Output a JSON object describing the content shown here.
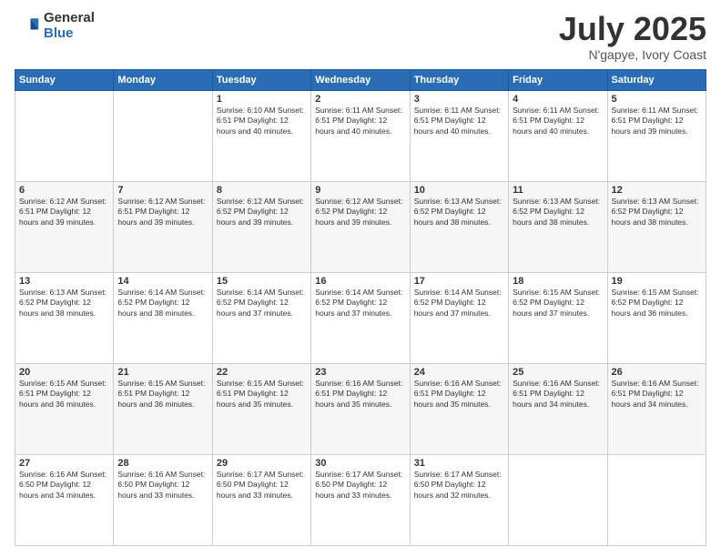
{
  "logo": {
    "general": "General",
    "blue": "Blue"
  },
  "title": "July 2025",
  "subtitle": "N'gapye, Ivory Coast",
  "days_of_week": [
    "Sunday",
    "Monday",
    "Tuesday",
    "Wednesday",
    "Thursday",
    "Friday",
    "Saturday"
  ],
  "weeks": [
    [
      {
        "day": "",
        "info": ""
      },
      {
        "day": "",
        "info": ""
      },
      {
        "day": "1",
        "info": "Sunrise: 6:10 AM\nSunset: 6:51 PM\nDaylight: 12 hours and 40 minutes."
      },
      {
        "day": "2",
        "info": "Sunrise: 6:11 AM\nSunset: 6:51 PM\nDaylight: 12 hours and 40 minutes."
      },
      {
        "day": "3",
        "info": "Sunrise: 6:11 AM\nSunset: 6:51 PM\nDaylight: 12 hours and 40 minutes."
      },
      {
        "day": "4",
        "info": "Sunrise: 6:11 AM\nSunset: 6:51 PM\nDaylight: 12 hours and 40 minutes."
      },
      {
        "day": "5",
        "info": "Sunrise: 6:11 AM\nSunset: 6:51 PM\nDaylight: 12 hours and 39 minutes."
      }
    ],
    [
      {
        "day": "6",
        "info": "Sunrise: 6:12 AM\nSunset: 6:51 PM\nDaylight: 12 hours and 39 minutes."
      },
      {
        "day": "7",
        "info": "Sunrise: 6:12 AM\nSunset: 6:51 PM\nDaylight: 12 hours and 39 minutes."
      },
      {
        "day": "8",
        "info": "Sunrise: 6:12 AM\nSunset: 6:52 PM\nDaylight: 12 hours and 39 minutes."
      },
      {
        "day": "9",
        "info": "Sunrise: 6:12 AM\nSunset: 6:52 PM\nDaylight: 12 hours and 39 minutes."
      },
      {
        "day": "10",
        "info": "Sunrise: 6:13 AM\nSunset: 6:52 PM\nDaylight: 12 hours and 38 minutes."
      },
      {
        "day": "11",
        "info": "Sunrise: 6:13 AM\nSunset: 6:52 PM\nDaylight: 12 hours and 38 minutes."
      },
      {
        "day": "12",
        "info": "Sunrise: 6:13 AM\nSunset: 6:52 PM\nDaylight: 12 hours and 38 minutes."
      }
    ],
    [
      {
        "day": "13",
        "info": "Sunrise: 6:13 AM\nSunset: 6:52 PM\nDaylight: 12 hours and 38 minutes."
      },
      {
        "day": "14",
        "info": "Sunrise: 6:14 AM\nSunset: 6:52 PM\nDaylight: 12 hours and 38 minutes."
      },
      {
        "day": "15",
        "info": "Sunrise: 6:14 AM\nSunset: 6:52 PM\nDaylight: 12 hours and 37 minutes."
      },
      {
        "day": "16",
        "info": "Sunrise: 6:14 AM\nSunset: 6:52 PM\nDaylight: 12 hours and 37 minutes."
      },
      {
        "day": "17",
        "info": "Sunrise: 6:14 AM\nSunset: 6:52 PM\nDaylight: 12 hours and 37 minutes."
      },
      {
        "day": "18",
        "info": "Sunrise: 6:15 AM\nSunset: 6:52 PM\nDaylight: 12 hours and 37 minutes."
      },
      {
        "day": "19",
        "info": "Sunrise: 6:15 AM\nSunset: 6:52 PM\nDaylight: 12 hours and 36 minutes."
      }
    ],
    [
      {
        "day": "20",
        "info": "Sunrise: 6:15 AM\nSunset: 6:51 PM\nDaylight: 12 hours and 36 minutes."
      },
      {
        "day": "21",
        "info": "Sunrise: 6:15 AM\nSunset: 6:51 PM\nDaylight: 12 hours and 36 minutes."
      },
      {
        "day": "22",
        "info": "Sunrise: 6:15 AM\nSunset: 6:51 PM\nDaylight: 12 hours and 35 minutes."
      },
      {
        "day": "23",
        "info": "Sunrise: 6:16 AM\nSunset: 6:51 PM\nDaylight: 12 hours and 35 minutes."
      },
      {
        "day": "24",
        "info": "Sunrise: 6:16 AM\nSunset: 6:51 PM\nDaylight: 12 hours and 35 minutes."
      },
      {
        "day": "25",
        "info": "Sunrise: 6:16 AM\nSunset: 6:51 PM\nDaylight: 12 hours and 34 minutes."
      },
      {
        "day": "26",
        "info": "Sunrise: 6:16 AM\nSunset: 6:51 PM\nDaylight: 12 hours and 34 minutes."
      }
    ],
    [
      {
        "day": "27",
        "info": "Sunrise: 6:16 AM\nSunset: 6:50 PM\nDaylight: 12 hours and 34 minutes."
      },
      {
        "day": "28",
        "info": "Sunrise: 6:16 AM\nSunset: 6:50 PM\nDaylight: 12 hours and 33 minutes."
      },
      {
        "day": "29",
        "info": "Sunrise: 6:17 AM\nSunset: 6:50 PM\nDaylight: 12 hours and 33 minutes."
      },
      {
        "day": "30",
        "info": "Sunrise: 6:17 AM\nSunset: 6:50 PM\nDaylight: 12 hours and 33 minutes."
      },
      {
        "day": "31",
        "info": "Sunrise: 6:17 AM\nSunset: 6:50 PM\nDaylight: 12 hours and 32 minutes."
      },
      {
        "day": "",
        "info": ""
      },
      {
        "day": "",
        "info": ""
      }
    ]
  ]
}
